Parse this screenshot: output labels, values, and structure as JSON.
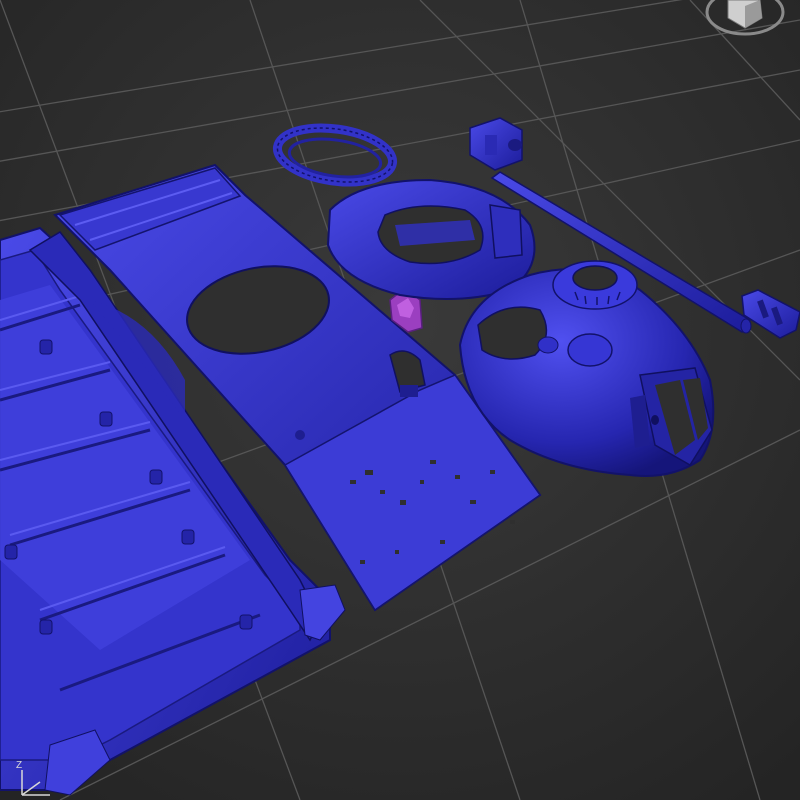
{
  "viewport": {
    "view": "Perspective",
    "background_color": "#2f2f2f",
    "grid_color": "#5a5a5a",
    "model_color": "#2f2fc8",
    "highlight_color": "#9b3fc0"
  },
  "parts": [
    {
      "name": "hull-lower"
    },
    {
      "name": "hull-deck-plate"
    },
    {
      "name": "turret-ring"
    },
    {
      "name": "turret-base"
    },
    {
      "name": "turret-shell"
    },
    {
      "name": "gun-barrel"
    },
    {
      "name": "muzzle-brake"
    },
    {
      "name": "mantlet-block"
    },
    {
      "name": "hatch-part-selected"
    }
  ],
  "gizmo": {
    "viewcube_icon": "viewcube-icon",
    "axis_icon": "axis-tripod-icon",
    "axis_label_z": "Z"
  }
}
